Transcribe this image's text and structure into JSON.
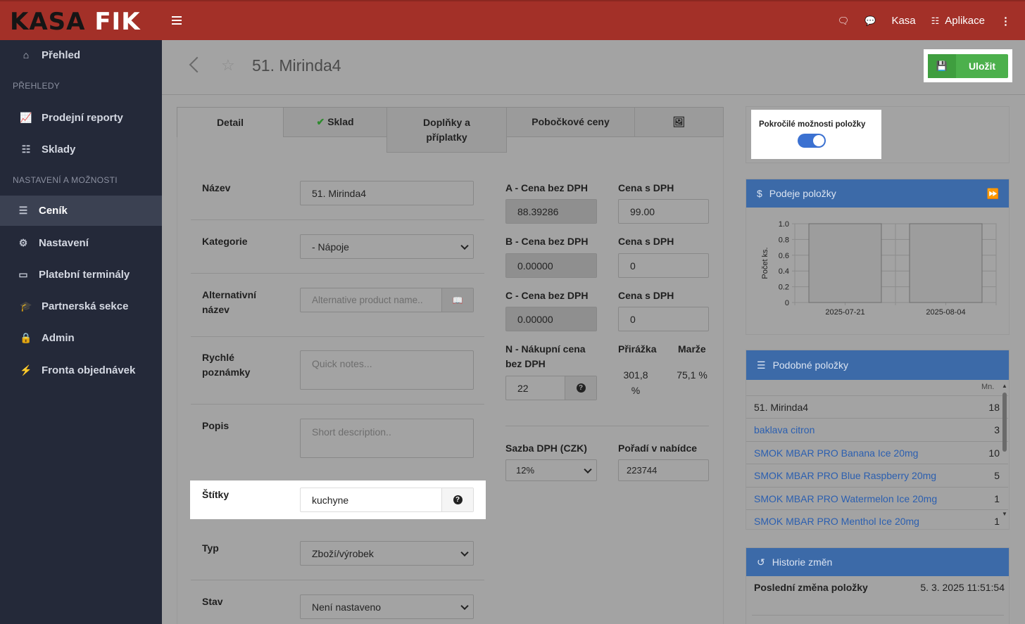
{
  "app": {
    "logo_part1": "KASA",
    "logo_part2": "FIK"
  },
  "topbar": {
    "chat_icon": "comments-icon",
    "msg_icon": "comment-icon",
    "kasa": "Kasa",
    "apps": "Aplikace"
  },
  "sidebar": {
    "items": [
      {
        "label": "Přehled",
        "icon": "home-icon"
      },
      {
        "label": "Prodejní reporty",
        "icon": "chart-line-icon"
      },
      {
        "label": "Sklady",
        "icon": "cubes-icon"
      },
      {
        "label": "Ceník",
        "icon": "list-icon"
      },
      {
        "label": "Nastavení",
        "icon": "gear-icon"
      },
      {
        "label": "Platební terminály",
        "icon": "credit-card-icon"
      },
      {
        "label": "Partnerská sekce",
        "icon": "graduation-cap-icon"
      },
      {
        "label": "Admin",
        "icon": "lock-icon"
      },
      {
        "label": "Fronta objednávek",
        "icon": "bolt-icon"
      }
    ],
    "headers": [
      "PŘEHLEDY",
      "NASTAVENÍ A MOŽNOSTI"
    ]
  },
  "header": {
    "title": "51. Mirinda4",
    "save": "Uložit"
  },
  "tabs": [
    "Detail",
    "Sklad",
    "Doplňky a příplatky",
    "Pobočkové ceny"
  ],
  "form": {
    "nazev_label": "Název",
    "nazev": "51. Mirinda4",
    "kategorie_label": "Kategorie",
    "kategorie": "- Nápoje",
    "alt_label": "Alternativní název",
    "alt_placeholder": "Alternative product name..",
    "notes_label": "Rychlé poznámky",
    "notes_placeholder": "Quick notes...",
    "popis_label": "Popis",
    "popis_placeholder": "Short description..",
    "stitky_label": "Štítky",
    "stitky": "kuchyne",
    "typ_label": "Typ",
    "typ": "Zboží/výrobek",
    "stav_label": "Stav",
    "stav": "Není nastaveno"
  },
  "prices": {
    "a_label": "A - Cena bez DPH",
    "a_value": "88.39286",
    "a_dph_label": "Cena s DPH",
    "a_dph": "99.00",
    "b_label": "B - Cena bez DPH",
    "b_value": "0.00000",
    "b_dph_label": "Cena s DPH",
    "b_dph": "0",
    "c_label": "C - Cena bez DPH",
    "c_value": "0.00000",
    "c_dph_label": "Cena s DPH",
    "c_dph": "0",
    "n_label": "N - Nákupní cena bez DPH",
    "n_value": "22",
    "prirazka_label": "Přirážka",
    "prirazka": "301,8 %",
    "marze_label": "Marže",
    "marze": "75,1 %",
    "sazba_label": "Sazba DPH (CZK)",
    "sazba": "12%",
    "poradi_label": "Pořadí v nabídce",
    "poradi": "223744"
  },
  "advanced": {
    "label": "Pokročilé možnosti položky",
    "enabled": true
  },
  "sales": {
    "title": "Podeje položky",
    "ylabel": "Počet ks."
  },
  "chart_data": {
    "type": "bar",
    "categories": [
      "2025-07-21",
      "2025-08-04"
    ],
    "values": [
      1,
      1
    ],
    "ylabel": "Počet ks.",
    "ylim": [
      0,
      1.0
    ],
    "yticks": [
      "1.0",
      "0.8",
      "0.6",
      "0.4",
      "0.2",
      "0"
    ],
    "grid": true
  },
  "similar": {
    "title": "Podobné položky",
    "col": "Mn.",
    "rows": [
      {
        "name": "51. Mirinda4",
        "count": "18",
        "link": false
      },
      {
        "name": "baklava citron",
        "count": "3",
        "link": true
      },
      {
        "name": "SMOK MBAR PRO Banana Ice 20mg",
        "count": "10",
        "link": true
      },
      {
        "name": "SMOK MBAR PRO Blue Raspberry 20mg",
        "count": "5",
        "link": true
      },
      {
        "name": "SMOK MBAR PRO Watermelon Ice 20mg",
        "count": "1",
        "link": true
      },
      {
        "name": "SMOK MBAR PRO Menthol Ice 20mg",
        "count": "1",
        "link": true
      }
    ]
  },
  "history": {
    "title": "Historie změn",
    "last_label": "Poslední změna položky",
    "last_value": "5. 3. 2025 11:51:54"
  }
}
